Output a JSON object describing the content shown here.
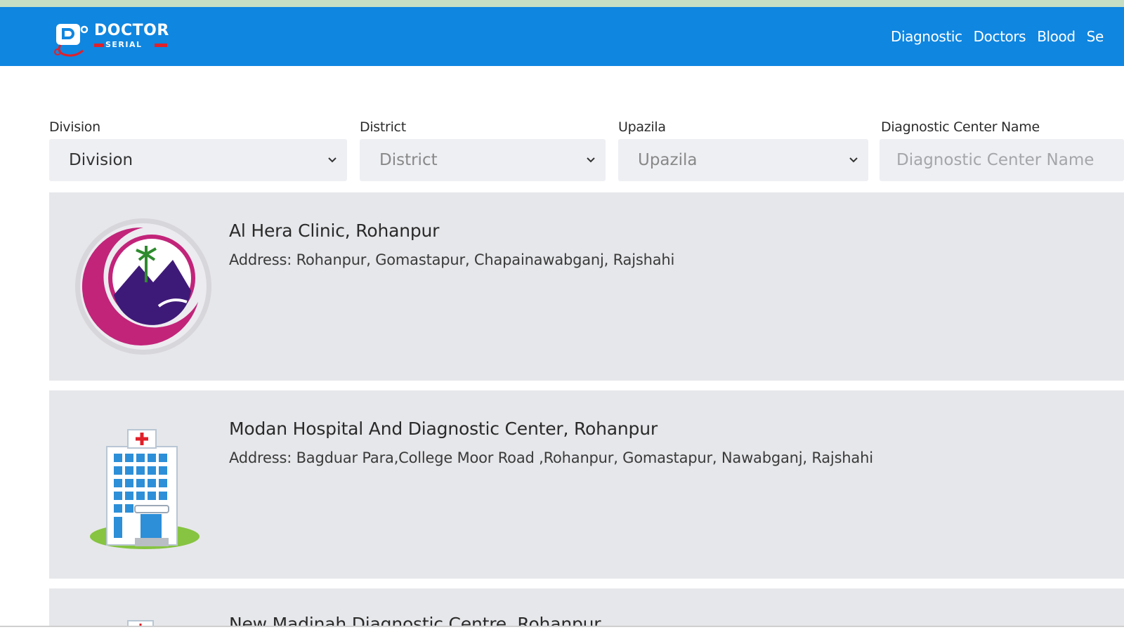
{
  "brand": {
    "logo_main": "DOCTOR",
    "logo_sub": "SERIAL",
    "nav_color": "#0f86e0"
  },
  "nav": {
    "items": [
      {
        "label": "Diagnostic"
      },
      {
        "label": "Doctors"
      },
      {
        "label": "Blood"
      },
      {
        "label": "Se"
      }
    ]
  },
  "filters": {
    "division": {
      "label": "Division",
      "value": "Division"
    },
    "district": {
      "label": "District",
      "value": "District"
    },
    "upazila": {
      "label": "Upazila",
      "value": "Upazila"
    },
    "center_name": {
      "label": "Diagnostic Center Name",
      "placeholder": "Diagnostic Center Name"
    }
  },
  "results": [
    {
      "name": "Al Hera Clinic, Rohanpur",
      "address": "Address: Rohanpur, Gomastapur, Chapainawabganj, Rajshahi",
      "icon": "clinic-logo-icon"
    },
    {
      "name": "Modan Hospital And Diagnostic Center, Rohanpur",
      "address": "Address: Bagduar Para,College Moor Road ,Rohanpur, Gomastapur, Nawabganj, Rajshahi",
      "icon": "hospital-building-icon"
    },
    {
      "name": "New Madinah Diagnostic Centre, Rohanpur",
      "icon": "hospital-building-icon"
    }
  ]
}
